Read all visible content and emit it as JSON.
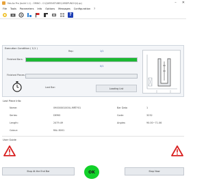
{
  "window": {
    "title": "Fab-Ax Pro (build 1.1) - ORINO - C:\\QUEENSTUBE\\CARDPUNCH(4).qcj",
    "minimize": "–",
    "close": "✕"
  },
  "menu": [
    "File",
    "Tools",
    "Parameters",
    "Info",
    "Options",
    "Messages",
    "Configuration",
    "?"
  ],
  "toolbar": {
    "icons": [
      "settings-wheel-icon",
      "camera-icon",
      "gear-icon",
      "chart-icon",
      "flag-icon",
      "profile-icon",
      "database-icon",
      "grid-icon",
      "help-icon"
    ],
    "help_label": "?"
  },
  "execution": {
    "title": "Execution Condition ( 1/1 )",
    "rep_label": "Rep:",
    "rep_value": "1/1",
    "finished_bars_label": "Finished Bars:",
    "finished_bars_progress": 1.0,
    "finished_bars_count": "0/1",
    "finished_pieces_label": "Finished Pieces:",
    "finished_pieces_progress": 0.0,
    "last_bar_label": "Last Bar:",
    "loading_list_label": "Loading List"
  },
  "last_piece": {
    "title": "Last Piece Info:",
    "name_label": "Name:",
    "name_value": "09000001000L.MRTY01",
    "series_label": "Series:",
    "series_value": "DEMO",
    "length_label": "Length:",
    "length_value": "2479.49",
    "colour_label": "Colour:",
    "colour_value": "RAL 8001",
    "bar_data_label": "Bar Data",
    "bar_data_value": "1",
    "code_label": "Code:",
    "code_value": "3232",
    "angles_label": "Angles:",
    "angles_value": "90.00~71.06"
  },
  "user_guide": {
    "title": "User Guide"
  },
  "footer": {
    "stop_end_bar_label": "Stop At the End Bar",
    "ok_label": "OK",
    "stop_now_label": "Stop Now"
  },
  "colors": {
    "progress_green": "#1cb832",
    "ok_green": "#12d12a",
    "warning_red": "#d81e1e",
    "accent_blue": "#3a5fb0"
  }
}
